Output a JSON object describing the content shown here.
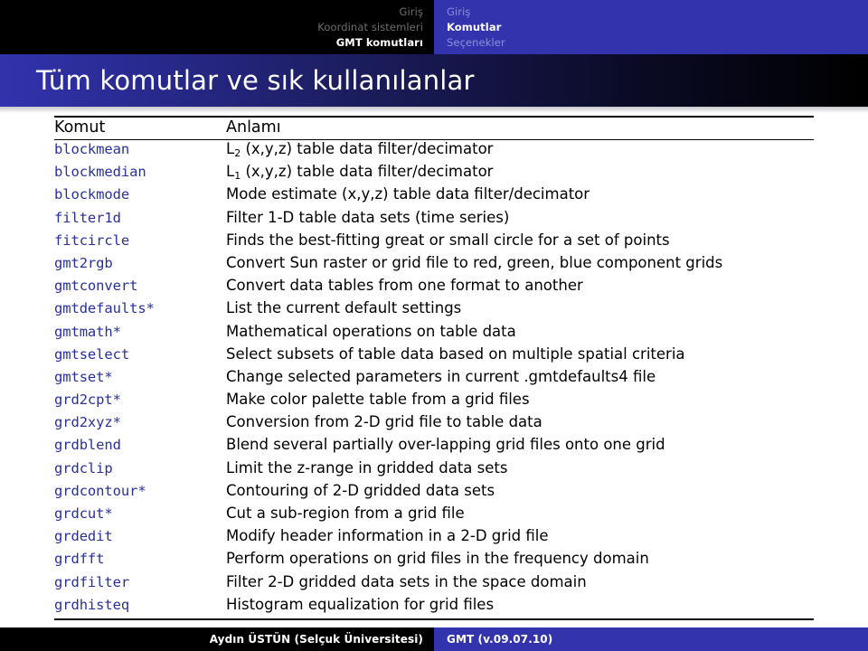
{
  "nav": {
    "left_section": [
      {
        "label": "Giriş",
        "active": false
      },
      {
        "label": "Koordinat sistemleri",
        "active": false
      },
      {
        "label": "GMT komutları",
        "active": true
      }
    ],
    "right_section": [
      {
        "label": "Giriş",
        "active": false
      },
      {
        "label": "Komutlar",
        "active": true
      },
      {
        "label": "Seçenekler",
        "active": false
      }
    ]
  },
  "slide": {
    "title": "Tüm komutlar ve sık kullanılanlar"
  },
  "table": {
    "headers": [
      "Komut",
      "Anlamı"
    ],
    "rows": [
      {
        "command": "blockmean",
        "description": "L2 (x,y,z) table data filter/decimator",
        "sub": "2"
      },
      {
        "command": "blockmedian",
        "description": "L1 (x,y,z) table data filter/decimator",
        "sub": "1"
      },
      {
        "command": "blockmode",
        "description": "Mode estimate (x,y,z) table data filter/decimator"
      },
      {
        "command": "filter1d",
        "description": "Filter 1-D table data sets (time series)"
      },
      {
        "command": "fitcircle",
        "description": "Finds the best-fitting great or small circle for a set of points"
      },
      {
        "command": "gmt2rgb",
        "description": "Convert Sun raster or grid file to red, green, blue component grids"
      },
      {
        "command": "gmtconvert",
        "description": "Convert data tables from one format to another"
      },
      {
        "command": "gmtdefaults*",
        "description": "List the current default settings"
      },
      {
        "command": "gmtmath*",
        "description": "Mathematical operations on table data"
      },
      {
        "command": "gmtselect",
        "description": "Select subsets of table data based on multiple spatial criteria"
      },
      {
        "command": "gmtset*",
        "description": "Change selected parameters in current .gmtdefaults4 file"
      },
      {
        "command": "grd2cpt*",
        "description": "Make color palette table from a grid files"
      },
      {
        "command": "grd2xyz*",
        "description": "Conversion from 2-D grid file to table data"
      },
      {
        "command": "grdblend",
        "description": "Blend several partially over-lapping grid files onto one grid"
      },
      {
        "command": "grdclip",
        "description": "Limit the z-range in gridded data sets"
      },
      {
        "command": "grdcontour*",
        "description": "Contouring of 2-D gridded data sets"
      },
      {
        "command": "grdcut*",
        "description": "Cut a sub-region from a grid file"
      },
      {
        "command": "grdedit",
        "description": "Modify header information in a 2-D grid file"
      },
      {
        "command": "grdfft",
        "description": "Perform operations on grid files in the frequency domain"
      },
      {
        "command": "grdfilter",
        "description": "Filter 2-D gridded data sets in the space domain"
      },
      {
        "command": "grdhisteq",
        "description": "Histogram equalization for grid files"
      }
    ]
  },
  "footer": {
    "author": "Aydın ÜSTÜN (Selçuk Üniversitesi)",
    "document": "GMT (v.09.07.10)"
  },
  "colors": {
    "nav_blue": "#3233ad",
    "nav_black": "#000000",
    "command_blue": "#29309c",
    "inactive_left": "#6e6e6e",
    "inactive_right": "#8f90d8"
  }
}
